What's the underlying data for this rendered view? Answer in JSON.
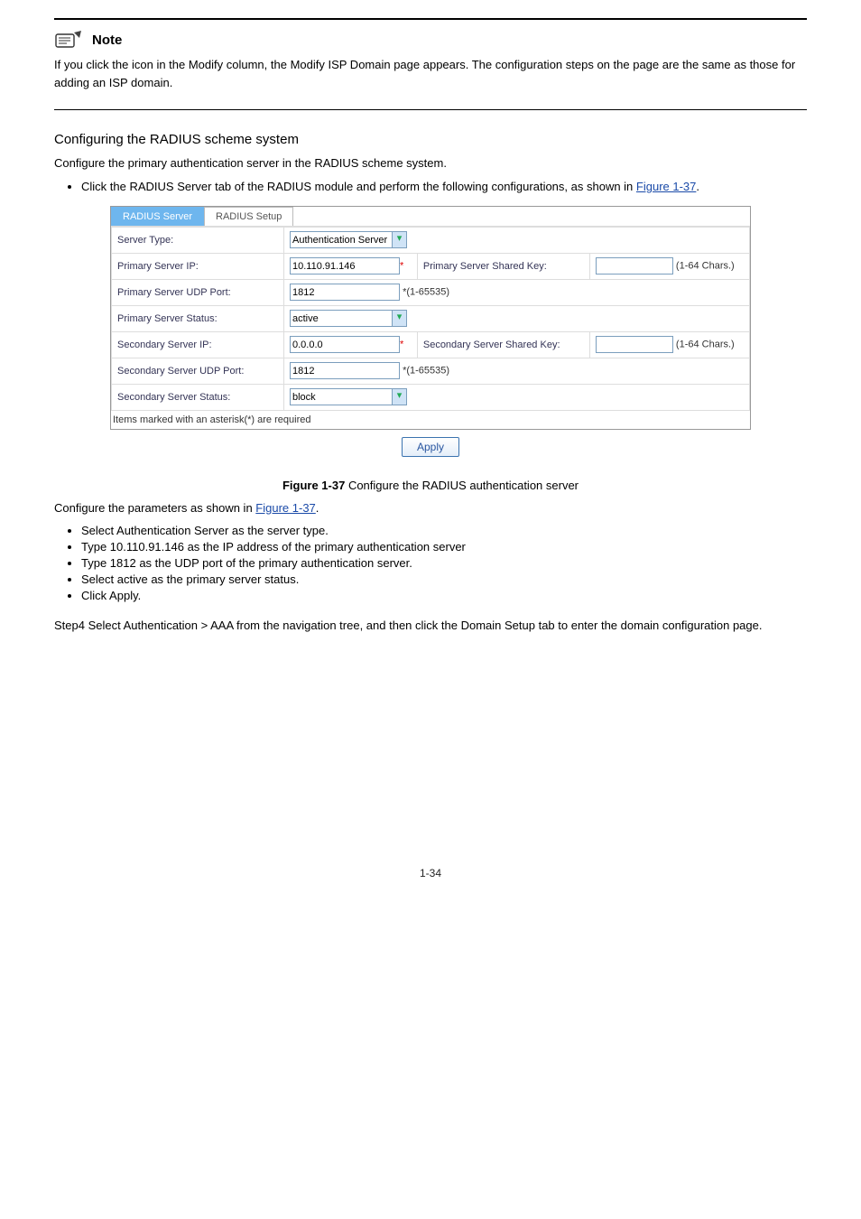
{
  "hr_spacer_top": "",
  "note": {
    "label": "Note",
    "text": "If you click the icon in the Modify column, the Modify ISP Domain page appears. The configuration steps on the page are the same as those for adding an ISP domain."
  },
  "section": {
    "heading": "Configuring the RADIUS scheme system",
    "intro": "Configure the primary authentication server in the RADIUS scheme system."
  },
  "screenshot": {
    "tabs": {
      "active": "RADIUS Server",
      "other": "RADIUS Setup"
    },
    "rows": {
      "server_type": {
        "label": "Server Type:",
        "value": "Authentication Server"
      },
      "primary_ip": {
        "label": "Primary Server IP:",
        "value": "10.110.91.146",
        "star": "*",
        "key_label": "Primary Server Shared Key:",
        "key_value": "",
        "key_hint": "(1-64 Chars.)"
      },
      "primary_port": {
        "label": "Primary Server UDP Port:",
        "value": "1812",
        "hint": "*(1-65535)"
      },
      "primary_status": {
        "label": "Primary Server Status:",
        "value": "active"
      },
      "secondary_ip": {
        "label": "Secondary Server IP:",
        "value": "0.0.0.0",
        "star": "*",
        "key_label": "Secondary Server Shared Key:",
        "key_value": "",
        "key_hint": "(1-64 Chars.)"
      },
      "secondary_port": {
        "label": "Secondary Server UDP Port:",
        "value": "1812",
        "hint": "*(1-65535)"
      },
      "secondary_status": {
        "label": "Secondary Server Status:",
        "value": "block"
      }
    },
    "required_note": "Items marked with an asterisk(*) are required",
    "apply": "Apply",
    "figure": "Figure 1-37",
    "figure_rest": " Configure the RADIUS authentication server"
  },
  "bullets": {
    "intro_prefix": "Configure the parameters as shown in ",
    "intro_link": "Figure 1-37",
    "intro_suffix": ".",
    "items": [
      "Select Authentication Server as the server type.",
      "Type 10.110.91.146 as the IP address of the primary authentication server",
      "Type 1812 as the UDP port of the primary authentication server.",
      "Select active as the primary server status.",
      "Click Apply."
    ]
  },
  "step4": {
    "lead": "Step4 Select Authentication > AAA from the navigation tree, and then click the Domain Setup tab to enter the domain configuration page.",
    "bullet_lead_text": "Click the RADIUS Server tab of the RADIUS module and perform the following configurations, as shown in ",
    "bullet_link": "Figure 1-37",
    "bullet_suffix": "."
  },
  "page_number": "1-34"
}
